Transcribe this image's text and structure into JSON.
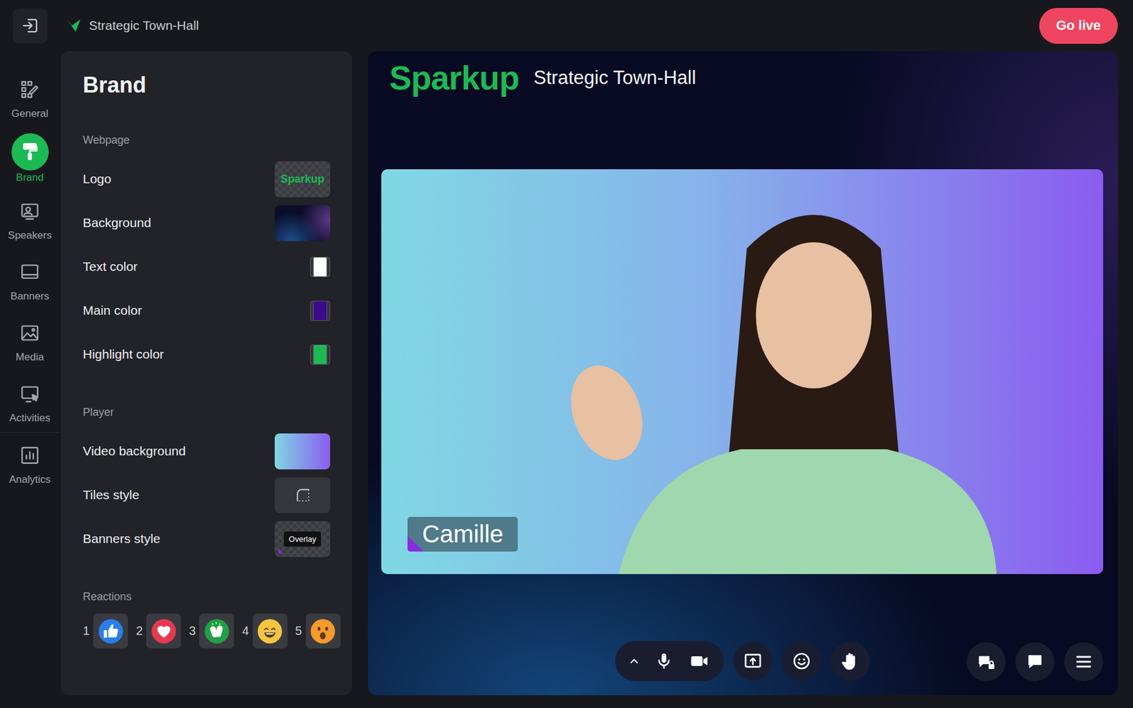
{
  "window": {
    "title": "Strategic Town-Hall"
  },
  "top_bar": {
    "go_live": "Go live"
  },
  "nav": {
    "items": [
      {
        "label": "General",
        "kind": "general",
        "selected": false
      },
      {
        "label": "Brand",
        "kind": "brand",
        "selected": true
      },
      {
        "label": "Speakers",
        "kind": "speakers",
        "selected": false
      },
      {
        "label": "Banners",
        "kind": "banners",
        "selected": false
      },
      {
        "label": "Media",
        "kind": "media",
        "selected": false
      },
      {
        "label": "Activities",
        "kind": "activities",
        "selected": false
      },
      {
        "label": "Analytics",
        "kind": "analytics",
        "selected": false
      }
    ]
  },
  "panel": {
    "title": "Brand",
    "sections": [
      {
        "label": "Webpage",
        "rows": [
          {
            "label": "Logo",
            "kind": "logo",
            "text": "Sparkup"
          },
          {
            "label": "Background",
            "kind": "image"
          },
          {
            "label": "Text color",
            "kind": "color",
            "color": "#ffffff"
          },
          {
            "label": "Main color",
            "kind": "color",
            "color": "#3b0a8c"
          },
          {
            "label": "Highlight color",
            "kind": "color",
            "color": "#1db954"
          }
        ]
      },
      {
        "label": "Player",
        "rows": [
          {
            "label": "Video background",
            "kind": "gradient"
          },
          {
            "label": "Tiles style",
            "kind": "tiles"
          },
          {
            "label": "Banners style",
            "kind": "banner",
            "text": "Overlay"
          }
        ]
      }
    ],
    "reactions": {
      "label": "Reactions",
      "items": [
        {
          "number": "1",
          "kind": "thumbs-up",
          "color": "#2b7de9"
        },
        {
          "number": "2",
          "kind": "heart",
          "color": "#e53950"
        },
        {
          "number": "3",
          "kind": "clap",
          "color": "#22a045"
        },
        {
          "number": "4",
          "kind": "smile",
          "color": "#f5c542"
        },
        {
          "number": "5",
          "kind": "wow",
          "color": "#f59a2b"
        }
      ]
    }
  },
  "stage": {
    "logo": "Sparkup",
    "title": "Strategic Town-Hall",
    "speaker": {
      "name": "Camille"
    }
  }
}
